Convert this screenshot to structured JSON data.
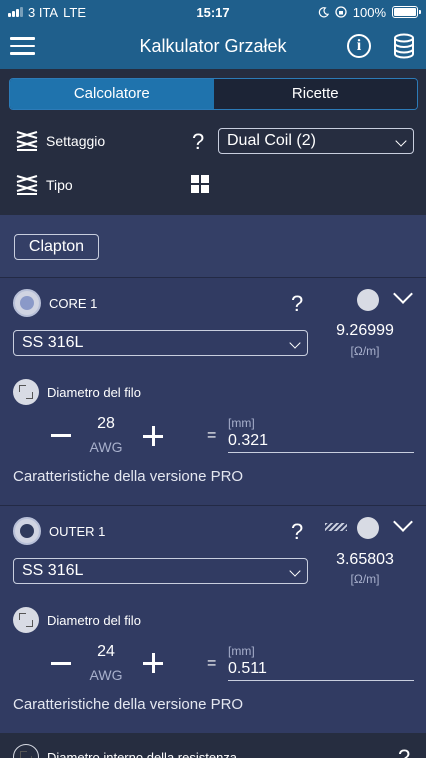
{
  "status_bar": {
    "carrier": "3 ITA",
    "network": "LTE",
    "time": "15:17",
    "battery": "100%"
  },
  "nav": {
    "title": "Kalkulator Grzałek"
  },
  "tabs": [
    {
      "label": "Calcolatore",
      "active": true
    },
    {
      "label": "Ricette",
      "active": false
    }
  ],
  "setup": {
    "settaggio_label": "Settaggio",
    "settaggio_value": "Dual Coil (2)",
    "tipo_label": "Tipo",
    "help": "?"
  },
  "clapton_button": "Clapton",
  "core": {
    "name": "CORE 1",
    "help": "?",
    "material": "SS 316L",
    "resistance": "9.26999",
    "resistance_unit": "[Ω/m]",
    "diameter_label": "Diametro del filo",
    "awg_value": "28",
    "awg_label": "AWG",
    "equals": "=",
    "mm_label": "[mm]",
    "mm_value": "0.321",
    "pro_text": "Caratteristiche della versione PRO"
  },
  "outer": {
    "name": "OUTER 1",
    "help": "?",
    "material": "SS 316L",
    "resistance": "3.65803",
    "resistance_unit": "[Ω/m]",
    "diameter_label": "Diametro del filo",
    "awg_value": "24",
    "awg_label": "AWG",
    "equals": "=",
    "mm_label": "[mm]",
    "mm_value": "0.511",
    "pro_text": "Caratteristiche della versione PRO"
  },
  "bottom": {
    "label": "Diametro interno della resistenza",
    "help": "?"
  },
  "colors": {
    "header": "#1f5f8c",
    "accent": "#1f73ad",
    "panel": "#313b62",
    "dark_panel": "#262d40"
  }
}
